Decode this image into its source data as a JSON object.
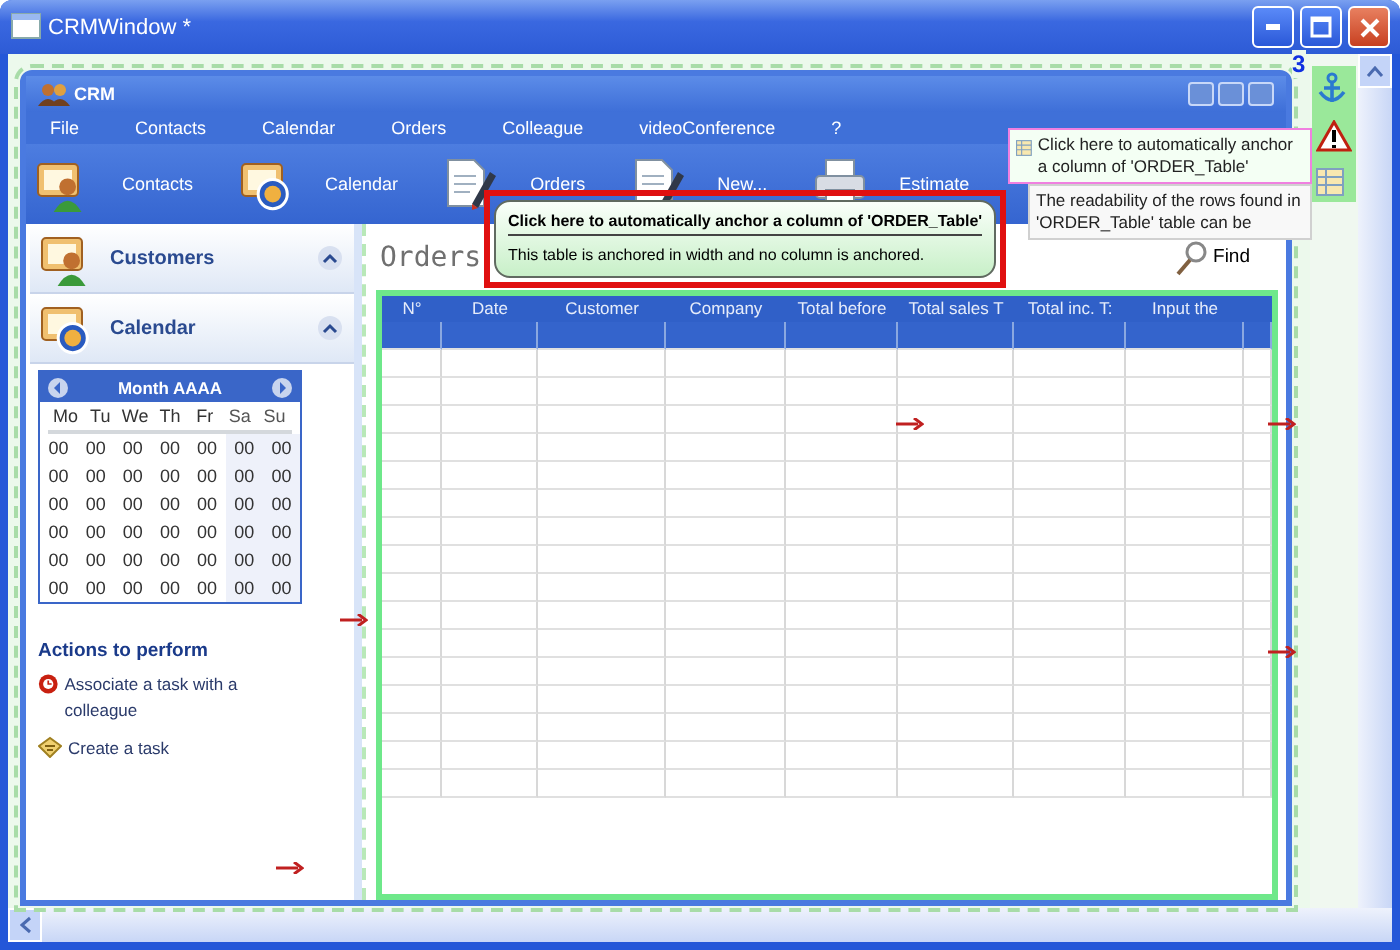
{
  "window": {
    "title": "CRMWindow *"
  },
  "form": {
    "title": "CRM"
  },
  "menu": [
    "File",
    "Contacts",
    "Calendar",
    "Orders",
    "Colleague",
    "videoConference",
    "?"
  ],
  "toolbar": [
    {
      "label": "Contacts",
      "kind": "contacts"
    },
    {
      "label": "Calendar",
      "kind": "calendar"
    },
    {
      "label": "Orders",
      "kind": "orders"
    },
    {
      "label": "New...",
      "kind": "new"
    },
    {
      "label": "Estimate",
      "kind": "estimate"
    }
  ],
  "sidebar": {
    "panels": [
      {
        "title": "Customers",
        "kind": "customers",
        "expanded": true
      },
      {
        "title": "Calendar",
        "kind": "calendar",
        "expanded": true
      }
    ],
    "calendar": {
      "title": "Month AAAA",
      "weekdays": [
        {
          "label": "Mo",
          "weekend": false
        },
        {
          "label": "Tu",
          "weekend": false
        },
        {
          "label": "We",
          "weekend": false
        },
        {
          "label": "Th",
          "weekend": false
        },
        {
          "label": "Fr",
          "weekend": false
        },
        {
          "label": "Sa",
          "weekend": true
        },
        {
          "label": "Su",
          "weekend": true
        }
      ],
      "weeks": [
        [
          "00",
          "00",
          "00",
          "00",
          "00",
          "00",
          "00"
        ],
        [
          "00",
          "00",
          "00",
          "00",
          "00",
          "00",
          "00"
        ],
        [
          "00",
          "00",
          "00",
          "00",
          "00",
          "00",
          "00"
        ],
        [
          "00",
          "00",
          "00",
          "00",
          "00",
          "00",
          "00"
        ],
        [
          "00",
          "00",
          "00",
          "00",
          "00",
          "00",
          "00"
        ],
        [
          "00",
          "00",
          "00",
          "00",
          "00",
          "00",
          "00"
        ]
      ]
    },
    "actions_title": "Actions to perform",
    "actions": [
      {
        "label": "Associate a task with a colleague",
        "kind": "colleague"
      },
      {
        "label": "Create a task",
        "kind": "task"
      }
    ]
  },
  "main": {
    "title": "Orders",
    "find": "Find",
    "table": {
      "columns": [
        "N°",
        "Date",
        "Customer",
        "Company",
        "Total before",
        "Total sales T",
        "Total inc. T:",
        "Input the"
      ],
      "rows": [
        {
          "selected": true
        },
        {
          "selected": false
        },
        {
          "selected": false
        },
        {
          "selected": false
        },
        {
          "selected": false
        },
        {
          "selected": false
        },
        {
          "selected": false
        },
        {
          "selected": false
        },
        {
          "selected": false
        },
        {
          "selected": false
        },
        {
          "selected": false
        },
        {
          "selected": false
        },
        {
          "selected": false
        },
        {
          "selected": false
        },
        {
          "selected": false
        },
        {
          "selected": false
        },
        {
          "selected": false
        }
      ]
    }
  },
  "tooltip": {
    "title": "Click here to automatically anchor a column of 'ORDER_Table'",
    "text": "This table is anchored in width and no column is anchored.",
    "highlighted": true
  },
  "anchor_panel": {
    "count": "3",
    "tools": [
      {
        "kind": "anchor"
      },
      {
        "kind": "warning"
      },
      {
        "kind": "table"
      }
    ],
    "hints": [
      {
        "text": "Click here to automatically anchor a column of 'ORDER_Table'",
        "selected": true
      },
      {
        "text": "The readability of the rows found in 'ORDER_Table' table can be",
        "selected": false
      }
    ]
  }
}
